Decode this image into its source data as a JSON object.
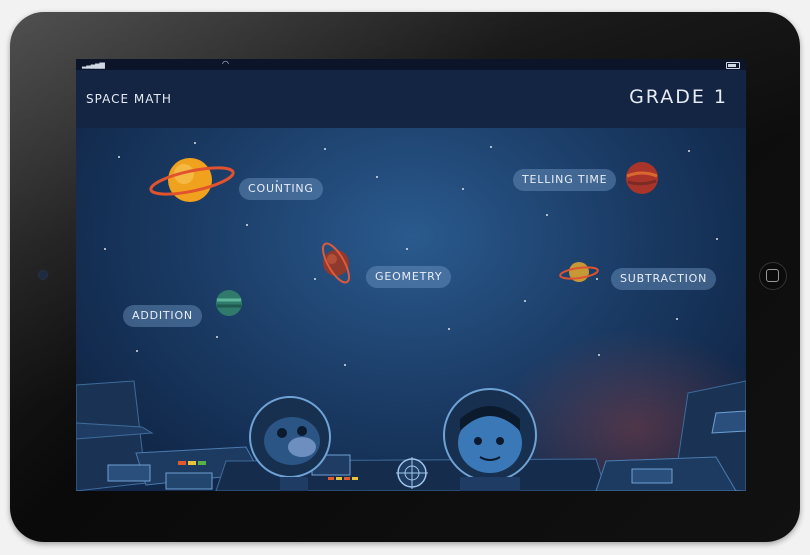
{
  "app": {
    "title": "SPACE MATH",
    "grade": "GRADE 1"
  },
  "topics": [
    {
      "label": "COUNTING",
      "planet": "orange-ringed-planet"
    },
    {
      "label": "TELLING TIME",
      "planet": "red-planet"
    },
    {
      "label": "GEOMETRY",
      "planet": "small-ringed-planet"
    },
    {
      "label": "SUBTRACTION",
      "planet": "yellow-ringed-planet"
    },
    {
      "label": "ADDITION",
      "planet": "teal-planet"
    }
  ],
  "colors": {
    "header": "#132542",
    "space": "#1b3c66",
    "pill": "#6e96c3"
  }
}
